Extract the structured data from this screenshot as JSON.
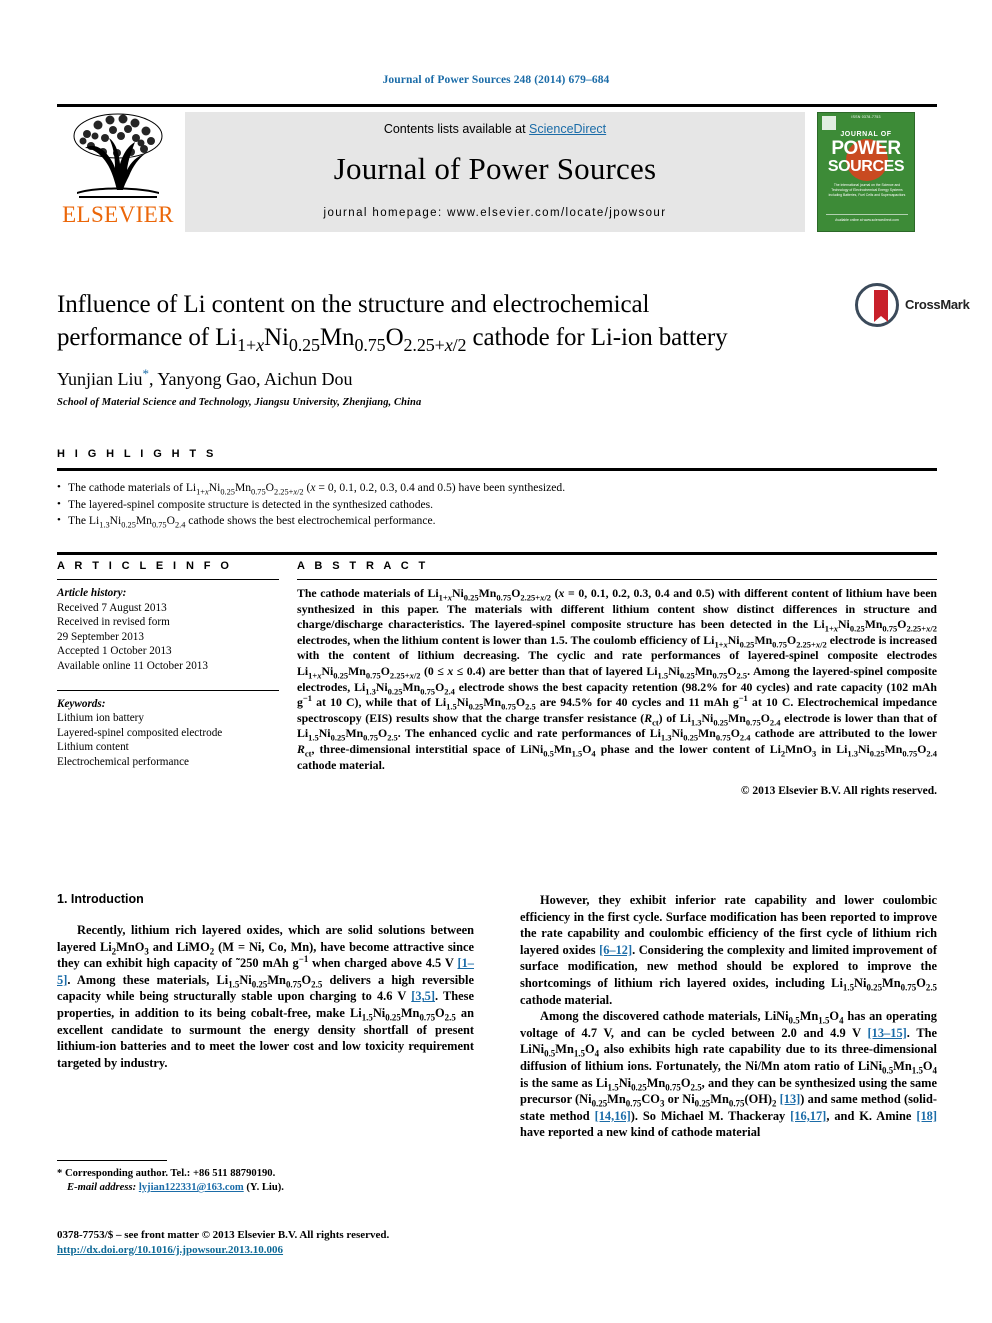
{
  "running_head": "Journal of Power Sources 248 (2014) 679–684",
  "masthead": {
    "contents_prefix": "Contents lists available at ",
    "sciencedirect": "ScienceDirect",
    "journal_title": "Journal of Power Sources",
    "homepage": "journal homepage: www.elsevier.com/locate/jpowsour",
    "publisher_logo_text": "ELSEVIER",
    "cover": {
      "line_head": "ISSN 0378-7753",
      "journal_of": "JOURNAL OF",
      "power": "POWER",
      "sources": "SOURCES",
      "subtitle": "The international journal on the Science and Technology of Electrochemical Energy Systems including Batteries, Fuel Cells and Supercapacitors",
      "footer": "Available online at www.sciencedirect.com"
    }
  },
  "title_block": {
    "title_line1": "Influence of Li content on the structure and electrochemical",
    "title_line2_pre": "performance of Li",
    "title_formula": "Li1+xNi0.25Mn0.75O2.25+x/2",
    "title_line2_post": " cathode for Li-ion battery",
    "authors": "Yunjian Liu*, Yanyong Gao, Aichun Dou",
    "affiliation": "School of Material Science and Technology, Jiangsu University, Zhenjiang, China",
    "crossmark_label": "CrossMark"
  },
  "highlights": {
    "label": "H I G H L I G H T S",
    "items": [
      "The cathode materials of Li1+xNi0.25Mn0.75O2.25+x/2 (x = 0, 0.1, 0.2, 0.3, 0.4 and 0.5) have been synthesized.",
      "The layered-spinel composite structure is detected in the synthesized cathodes.",
      "The Li1.3Ni0.25Mn0.75O2.4 cathode shows the best electrochemical performance."
    ]
  },
  "article_info": {
    "label": "A R T I C L E   I N F O",
    "history_title": "Article history:",
    "history": [
      "Received 7 August 2013",
      "Received in revised form",
      "29 September 2013",
      "Accepted 1 October 2013",
      "Available online 11 October 2013"
    ],
    "keywords_title": "Keywords:",
    "keywords": [
      "Lithium ion battery",
      "Layered-spinel composited electrode",
      "Lithium content",
      "Electrochemical performance"
    ]
  },
  "abstract": {
    "label": "A B S T R A C T",
    "text": "The cathode materials of Li1+xNi0.25Mn0.75O2.25+x/2 (x = 0, 0.1, 0.2, 0.3, 0.4 and 0.5) with different content of lithium have been synthesized in this paper. The materials with different lithium content show distinct differences in structure and charge/discharge characteristics. The layered-spinel composite structure has been detected in the Li1+xNi0.25Mn0.75O2.25+x/2 electrodes, when the lithium content is lower than 1.5. The coulomb efficiency of Li1+xNi0.25Mn0.75O2.25+x/2 electrode is increased with the content of lithium decreasing. The cyclic and rate performances of layered-spinel composite electrodes Li1+xNi0.25Mn0.75O2.25+x/2 (0 ≤ x ≤ 0.4) are better than that of layered Li1.5Ni0.25Mn0.75O2.5. Among the layered-spinel composite electrodes, Li1.3Ni0.25Mn0.75O2.4 electrode shows the best capacity retention (98.2% for 40 cycles) and rate capacity (102 mAh g−1 at 10 C), while that of Li1.5Ni0.25Mn0.75O2.5 are 94.5% for 40 cycles and 11 mAh g−1 at 10 C. Electrochemical impedance spectroscopy (EIS) results show that the charge transfer resistance (Rct) of Li1.3Ni0.25Mn0.75O2.4 electrode is lower than that of Li1.5Ni0.25Mn0.75O2.5. The enhanced cyclic and rate performances of Li1.3Ni0.25Mn0.75O2.4 cathode are attributed to the lower Rct, three-dimensional interstitial space of LiNi0.5Mn1.5O4 phase and the lower content of Li2MnO3 in Li1.3Ni0.25Mn0.75O2.4 cathode material.",
    "copyright": "© 2013 Elsevier B.V. All rights reserved."
  },
  "body": {
    "section1_title": "1.  Introduction",
    "para1_parts": {
      "a": "Recently, lithium rich layered oxides, which are solid solutions between layered Li2MnO3 and LiMO2 (M = Ni, Co, Mn), have become attractive since they can exhibit high capacity of ~250 mAh g−1 when charged above 4.5 V ",
      "ref1": "[1–5]",
      "b": ". Among these materials, Li1.5Ni0.25Mn0.75O2.5 delivers a high reversible capacity while being structurally stable upon charging to 4.6 V ",
      "ref2": "[3,5]",
      "c": ". These properties, in addition to its being cobalt-free, make Li1.5Ni0.25Mn0.75O2.5 an excellent candidate to surmount the energy density shortfall of present lithium-ion batteries and to meet the lower cost and low toxicity requirement targeted by industry."
    },
    "para2_parts": {
      "a": "However, they exhibit inferior rate capability and lower coulombic efficiency in the first cycle. Surface modification has been reported to improve the rate capability and coulombic efficiency of the first cycle of lithium rich layered oxides ",
      "ref1": "[6–12]",
      "b": ". Considering the complexity and limited improvement of surface modification, new method should be explored to improve the shortcomings of lithium rich layered oxides, including Li1.5Ni0.25Mn0.75O2.5 cathode material."
    },
    "para3_parts": {
      "a": "Among the discovered cathode materials, LiNi0.5Mn1.5O4 has an operating voltage of 4.7 V, and can be cycled between 2.0 and 4.9 V ",
      "ref1": "[13–15]",
      "b": ". The LiNi0.5Mn1.5O4 also exhibits high rate capability due to its three-dimensional diffusion of lithium ions. Fortunately, the Ni/Mn atom ratio of LiNi0.5Mn1.5O4 is the same as Li1.5Ni0.25Mn0.75O2.5, and they can be synthesized using the same precursor (Ni0.25Mn0.75CO3 or Ni0.25Mn0.75(OH)2 ",
      "ref2": "[13]",
      "c": ") and same method (solid-state method ",
      "ref3": "[14,16]",
      "d": "). So Michael M. Thackeray ",
      "ref4": "[16,17]",
      "e": ", and K. Amine ",
      "ref5": "[18]",
      "f": " have reported a new kind of cathode material"
    }
  },
  "footnote": {
    "corresponding": "* Corresponding author. Tel.: +86 511 88790190.",
    "email_label": "E-mail address:",
    "email": "lyjian122331@163.com",
    "email_suffix": " (Y. Liu)."
  },
  "bottom": {
    "issn_line": "0378-7753/$ – see front matter © 2013 Elsevier B.V. All rights reserved.",
    "doi": "http://dx.doi.org/10.1016/j.jpowsour.2013.10.006"
  },
  "colors": {
    "link_blue": "#1b6ca8",
    "elsevier_orange": "#eb6608",
    "cover_green": "#3d8b37",
    "crossmark_red": "#c8202a"
  }
}
